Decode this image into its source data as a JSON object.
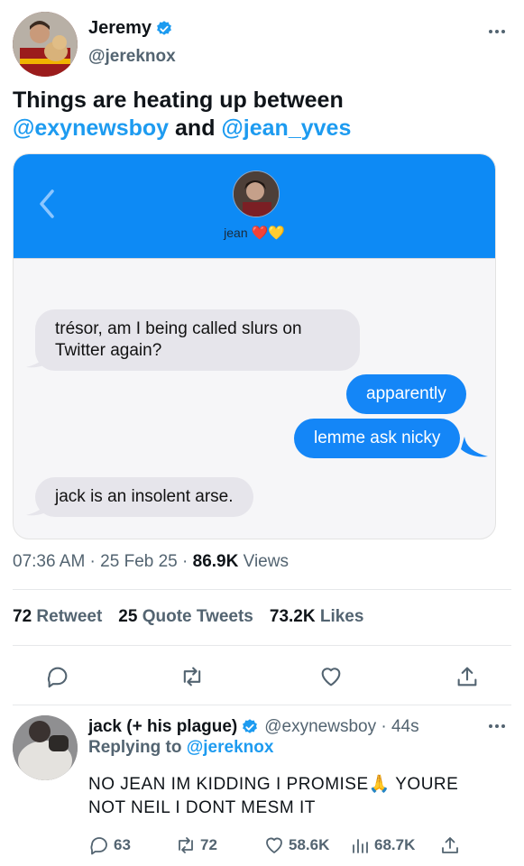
{
  "tweet": {
    "author_name": "Jeremy",
    "author_handle": "@jereknox",
    "text_part1": "Things are heating up between",
    "mention1": "@exynewsboy",
    "text_and": "and",
    "mention2": "@jean_yves",
    "time": "07:36 AM",
    "date": "25 Feb 25",
    "views_count": "86.9K",
    "views_label": "Views",
    "retweets_count": "72",
    "retweets_label": "Retweet",
    "quotes_count": "25",
    "quotes_label": "Quote Tweets",
    "likes_count": "73.2K",
    "likes_label": "Likes"
  },
  "chat": {
    "contact_name": "jean",
    "contact_emoji": "❤️💛",
    "messages": [
      {
        "direction": "incoming",
        "text": "trésor, am I being called slurs on Twitter again?"
      },
      {
        "direction": "outgoing",
        "text": "apparently"
      },
      {
        "direction": "outgoing",
        "text": "lemme ask nicky"
      },
      {
        "direction": "incoming",
        "text": "jack is an insolent arse."
      }
    ]
  },
  "reply": {
    "author_name": "jack (+ his plague)",
    "author_handle": "@exynewsboy",
    "time": "44s",
    "replying_prefix": "Replying to",
    "replying_to": "@jereknox",
    "text": "NO JEAN IM KIDDING I PROMISE🙏  YOURE NOT NEIL I DONT MESM IT",
    "reply_count": "63",
    "retweet_count": "72",
    "like_count": "58.6K",
    "view_count": "68.7K"
  },
  "colors": {
    "accent": "#1d9bf0",
    "chat_header": "#0d8af5",
    "outgoing_bubble": "#1486f7",
    "incoming_bubble": "#e6e5eb",
    "secondary_text": "#536471"
  },
  "icons": [
    "verified-badge-icon",
    "more-icon",
    "back-chevron-icon",
    "reply-icon",
    "retweet-icon",
    "like-icon",
    "share-icon",
    "views-icon"
  ]
}
